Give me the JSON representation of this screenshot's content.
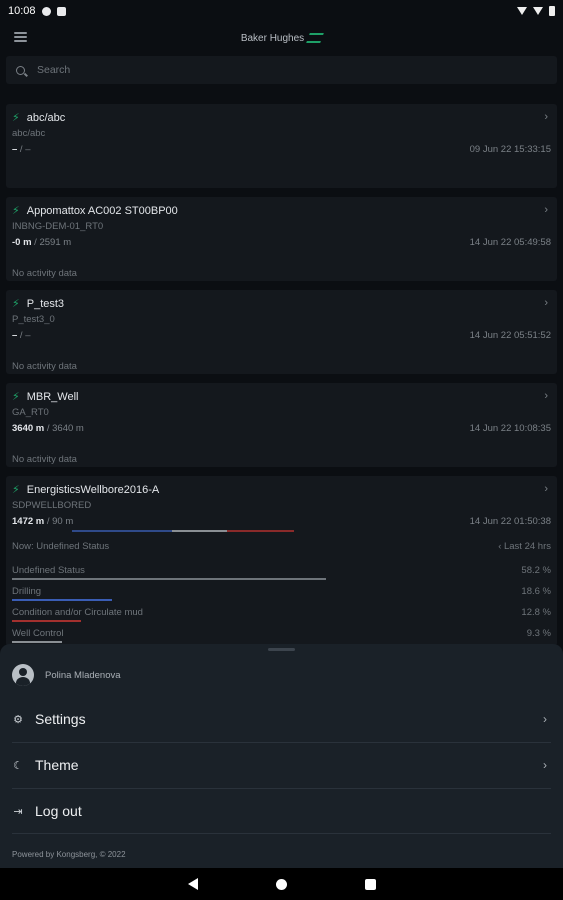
{
  "status_bar": {
    "time": "10:08"
  },
  "app_bar": {
    "brand": "Baker Hughes"
  },
  "search": {
    "placeholder": "Search"
  },
  "wells": [
    {
      "title": "abc/abc",
      "subtitle": "abc/abc",
      "depth_current": "–",
      "depth_total": " / –",
      "timestamp": "09 Jun 22 15:33:15",
      "activity": ""
    },
    {
      "title": "Appomattox AC002 ST00BP00",
      "subtitle": "INBNG-DEM-01_RT0",
      "depth_current": "-0 m",
      "depth_total": " / 2591 m",
      "timestamp": "14 Jun 22 05:49:58",
      "activity": "No activity data"
    },
    {
      "title": "P_test3",
      "subtitle": "P_test3_0",
      "depth_current": "–",
      "depth_total": " / –",
      "timestamp": "14 Jun 22 05:51:52",
      "activity": "No activity data"
    },
    {
      "title": "MBR_Well",
      "subtitle": "GA_RT0",
      "depth_current": "3640 m",
      "depth_total": " / 3640 m",
      "timestamp": "14 Jun 22 10:08:35",
      "activity": "No activity data"
    },
    {
      "title": "EnergisticsWellbore2016-A",
      "subtitle": "SDPWELLBORED",
      "depth_current": "1472 m",
      "depth_total": " / 90 m",
      "timestamp": "14 Jun 22 01:50:38",
      "activity": ""
    }
  ],
  "activity_card": {
    "now_label": "Now: Undefined Status",
    "range_label": "‹ Last 24 hrs",
    "bar_fractions": [
      0.45,
      0.25,
      0.3
    ],
    "bar_colors": [
      "#2f4a8a",
      "#8a8f94",
      "#8a2a2a"
    ],
    "stats": [
      {
        "label": "Undefined Status",
        "value": "58.2 %",
        "fraction": 0.582,
        "color": "#6e747a"
      },
      {
        "label": "Drilling",
        "value": "18.6 %",
        "fraction": 0.186,
        "color": "#3a5db5"
      },
      {
        "label": "Condition and/or Circulate mud",
        "value": "12.8 %",
        "fraction": 0.128,
        "color": "#a3302e"
      },
      {
        "label": "Well Control",
        "value": "9.3 %",
        "fraction": 0.093,
        "color": "#8a8f94"
      }
    ]
  },
  "sheet": {
    "user_name": "Polina Mladenova",
    "items": [
      {
        "label": "Settings",
        "icon": "gear-icon"
      },
      {
        "label": "Theme",
        "icon": "moon-icon"
      },
      {
        "label": "Log out",
        "icon": "logout-icon"
      }
    ],
    "powered_by": "Powered by Kongsberg, © 2022"
  },
  "colors": {
    "accent": "#1ea067",
    "background": "#0b0e12",
    "card": "#14181d",
    "sheet": "#1a2128"
  }
}
